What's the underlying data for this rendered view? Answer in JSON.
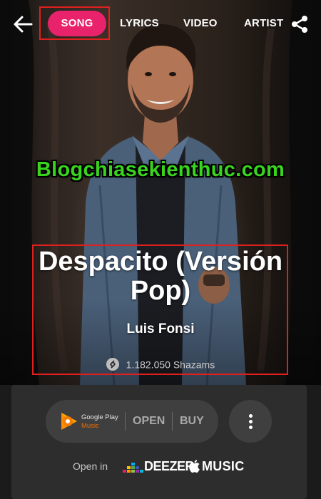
{
  "nav": {
    "tabs": [
      {
        "label": "SONG",
        "selected": true
      },
      {
        "label": "LYRICS",
        "selected": false
      },
      {
        "label": "VIDEO",
        "selected": false
      },
      {
        "label": "ARTIST",
        "selected": false
      }
    ],
    "back_icon": "arrow-left-icon",
    "share_icon": "share-icon"
  },
  "watermark": "Blogchiasekienthuc.com",
  "song": {
    "title": "Despacito (Versión Pop)",
    "artist": "Luis Fonsi",
    "shazam_count": "1.182.050 Shazams"
  },
  "provider": {
    "name": "Google Play",
    "sub": "Music",
    "open_label": "OPEN",
    "buy_label": "BUY"
  },
  "open_in": {
    "label": "Open in",
    "services": [
      "DEEZER",
      "MUSIC"
    ]
  },
  "colors": {
    "accent": "#e8226b",
    "highlight_box": "#e0201e",
    "watermark": "#39d51e",
    "panel": "#2d2d2d"
  }
}
